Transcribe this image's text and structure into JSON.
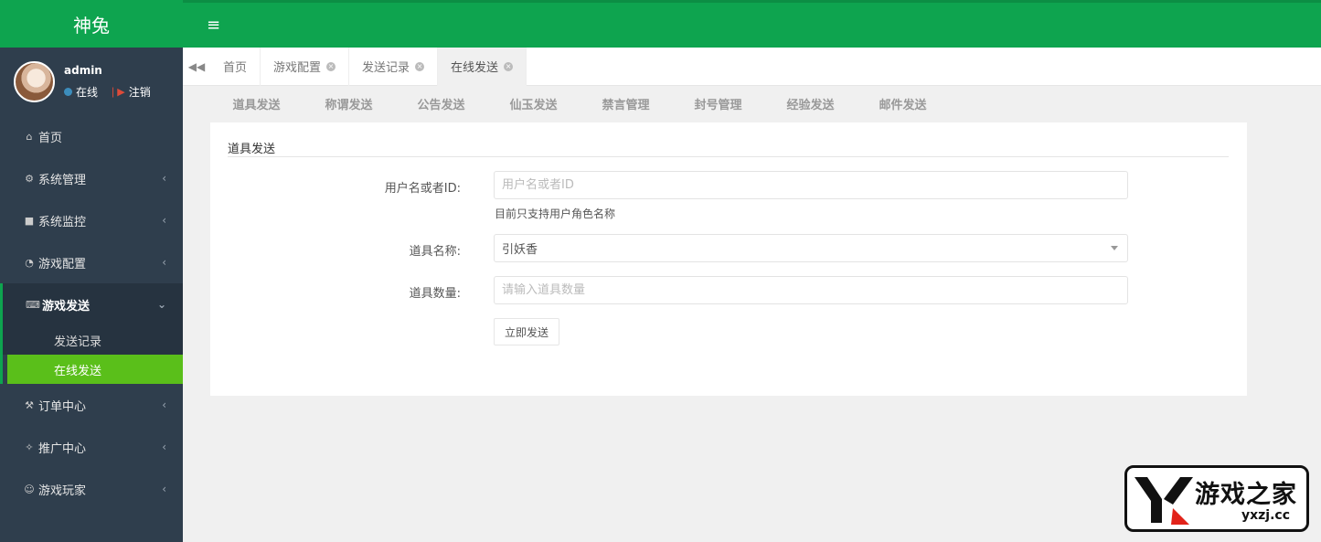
{
  "brand": {
    "name": "神兔"
  },
  "user": {
    "name": "admin",
    "status_label": "在线",
    "logout_label": "注销"
  },
  "sidebar": {
    "items": [
      {
        "label": "首页",
        "icon": "home-icon"
      },
      {
        "label": "系统管理",
        "icon": "gear-icon"
      },
      {
        "label": "系统监控",
        "icon": "video-icon"
      },
      {
        "label": "游戏配置",
        "icon": "dashboard-icon"
      },
      {
        "label": "游戏发送",
        "icon": "keyboard-icon"
      },
      {
        "label": "订单中心",
        "icon": "wrench-icon"
      },
      {
        "label": "推广中心",
        "icon": "handshake-icon"
      },
      {
        "label": "游戏玩家",
        "icon": "user-icon"
      }
    ],
    "sub_items": [
      {
        "label": "发送记录"
      },
      {
        "label": "在线发送"
      }
    ]
  },
  "tabs": [
    {
      "label": "首页"
    },
    {
      "label": "游戏配置"
    },
    {
      "label": "发送记录"
    },
    {
      "label": "在线发送"
    }
  ],
  "subnav": [
    "道具发送",
    "称谓发送",
    "公告发送",
    "仙玉发送",
    "禁言管理",
    "封号管理",
    "经验发送",
    "邮件发送"
  ],
  "form": {
    "title": "道具发送",
    "user_label": "用户名或者ID:",
    "user_placeholder": "用户名或者ID",
    "user_hint": "目前只支持用户角色名称",
    "item_label": "道具名称:",
    "item_value": "引妖香",
    "qty_label": "道具数量:",
    "qty_placeholder": "请输入道具数量",
    "submit_label": "立即发送"
  },
  "watermark": {
    "text": "游戏之家",
    "url": "yxzj.cc"
  },
  "colors": {
    "accent": "#0ea44f",
    "sidebar": "#2f3e4d",
    "active_sub": "#5abf1a"
  }
}
